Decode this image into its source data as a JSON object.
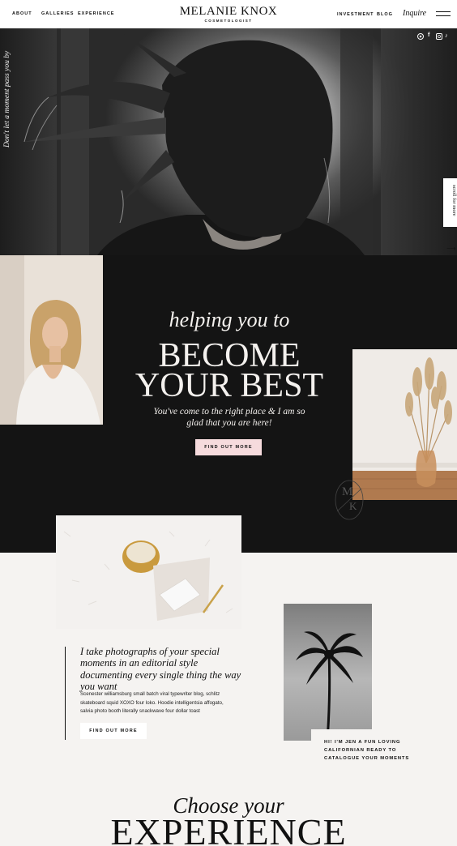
{
  "header": {
    "nav_left": [
      "ABOUT",
      "GALLERIES",
      "EXPERIENCE"
    ],
    "brand": {
      "name": "MELANIE KNOX",
      "subtitle": "COSMETOLOGIST"
    },
    "nav_right": [
      "INVESTMENT",
      "BLOG"
    ],
    "inquire_label": "Inquire",
    "menu_icon": "hamburger-icon"
  },
  "hero": {
    "quote": "Don't let a moment pass you by",
    "social_icons": [
      "pinterest-icon",
      "facebook-icon",
      "instagram-icon",
      "tiktok-icon"
    ],
    "social_glyphs": [
      "℗",
      "f",
      "◎",
      "♪"
    ],
    "scroll_label": "scroll for more",
    "scroll_arrow": "⟶"
  },
  "feature": {
    "script": "helping you to",
    "headline_1": "BECOME",
    "headline_2": "YOUR BEST",
    "subtext": "You've come to the right place & I am so glad that you are here!",
    "cta_label": "FIND OUT MORE",
    "monogram_top": "M",
    "monogram_bottom": "K"
  },
  "about": {
    "heading": "I take photographs of your special moments in an editorial style documenting every single thing the way you want",
    "body": "Scenester williamsburg small batch viral typewriter blog, schlitz skateboard squid XOXO four loko. Hoodie intelligentsia affogato, salvia photo booth literally snackwave four dollar toast",
    "cta_label": "FIND OUT MORE",
    "card_text": "HI! I'M JEN A FUN LOVING CALIFORNIAN READY TO CATALOGUE YOUR MOMENTS"
  },
  "experience": {
    "script": "Choose your",
    "headline": "EXPERIENCE"
  },
  "colors": {
    "dark_band": "#141414",
    "page_bg": "#f5f3f1",
    "button_pink": "#f6dbdd",
    "text_light": "#f4f1ee"
  }
}
